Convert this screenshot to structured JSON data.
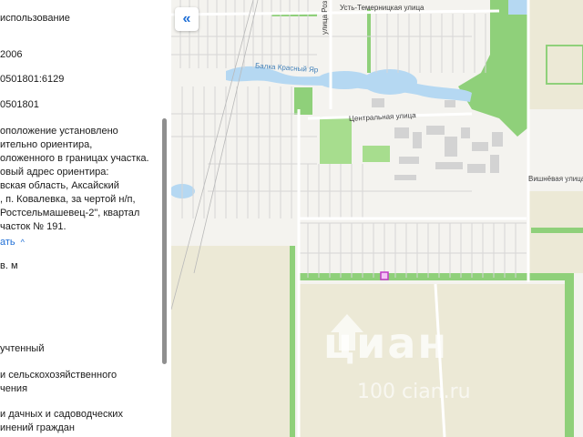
{
  "panel": {
    "lines": [
      "использование",
      "2006",
      "0501801:6129",
      "0501801",
      "оположение установлено",
      "ительно ориентира,",
      "оложенного в границах участка.",
      "овый адрес ориентира:",
      "вская область, Аксайский",
      ", п. Ковалевка, за чертой н/п,",
      "Ростсельмашевец-2\", квартал",
      "часток № 191.",
      "в. м",
      "учтенный",
      "и сельскохозяйственного",
      "чения",
      "и дачных и садоводческих",
      "инений граждан"
    ],
    "collapse_link": "ать"
  },
  "map": {
    "collapse_icon": "«",
    "streets": {
      "ust_temernitskaya": "Усть-Темерницкая улица",
      "balka": "Балка Красный Яр",
      "rozy": "улица Роз",
      "centralnaya": "Центральная улица",
      "vishnevaya": "Вишнёвая улица"
    },
    "watermark": "циан",
    "watermark_sub": "100 cian.ru"
  },
  "colors": {
    "link": "#1f6fd6",
    "forest": "#8fd07a",
    "water": "#b5d8f2",
    "marker": "#c23bc7",
    "field": "#ece9d6"
  }
}
